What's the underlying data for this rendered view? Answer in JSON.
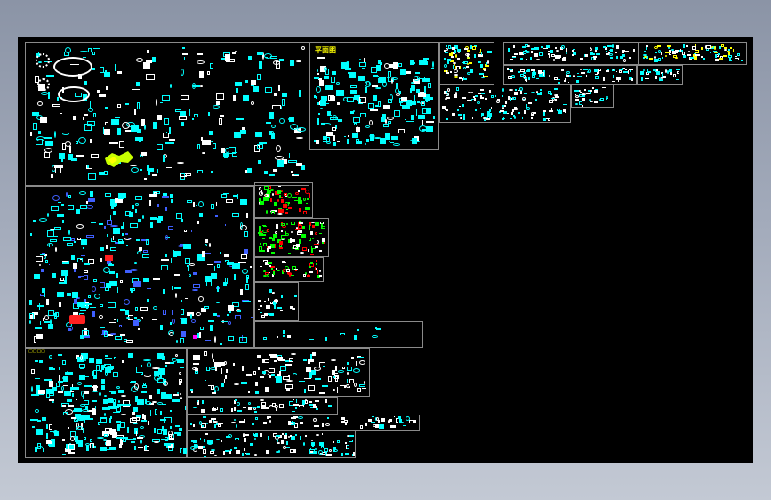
{
  "window": {
    "background_gradient": [
      "#8b94a6",
      "#c3c9d4"
    ],
    "canvas_color": "#000000"
  },
  "sheets": {
    "floor_plan_title": "平面图",
    "bottom_left_title": "□□□□"
  },
  "palette": {
    "cyan": "#00ffff",
    "white": "#ffffff",
    "green": "#00ff00",
    "red": "#ff0000",
    "yellow": "#ffff00",
    "blue": "#3f5fff",
    "magenta": "#ff00ff",
    "frame": "#8a8a8a"
  }
}
